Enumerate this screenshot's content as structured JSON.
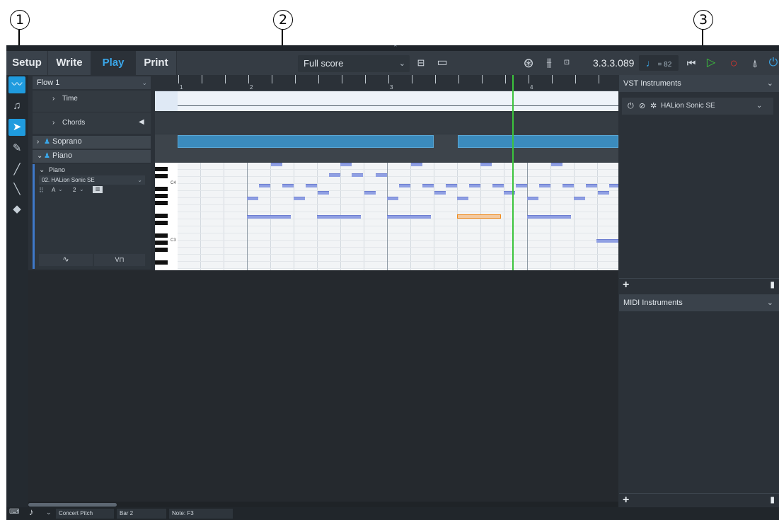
{
  "callouts": [
    "1",
    "2",
    "3"
  ],
  "toolbar": {
    "tabs": [
      "Setup",
      "Write",
      "Play",
      "Print"
    ],
    "active_tab": "Play",
    "layout_select": "Full score",
    "time_display": "3.3.3.089",
    "tempo": "= 82"
  },
  "tracks": {
    "flow": "Flow 1",
    "time": "Time",
    "chords": "Chords",
    "soprano": "Soprano",
    "piano": "Piano",
    "piano_sub": "Piano",
    "instrument": "02. HALion Sonic SE",
    "channel": "A",
    "program": "2"
  },
  "timeline": {
    "bars": [
      "1",
      "2",
      "3",
      "4"
    ],
    "key_labels": [
      "C4",
      "C3"
    ]
  },
  "right_panel": {
    "vst_title": "VST Instruments",
    "vst_item": "HALion Sonic SE",
    "midi_title": "MIDI Instruments"
  },
  "status": {
    "concert_pitch": "Concert Pitch",
    "bar": "Bar 2",
    "note": "Note: F3"
  },
  "colors": {
    "accent": "#3aa6e8",
    "play_green": "#3cc43c",
    "record_red": "#e0342c",
    "region": "#3b8bbd",
    "note_fill": "#8f9fe3",
    "selected_note": "#f08a1c"
  }
}
